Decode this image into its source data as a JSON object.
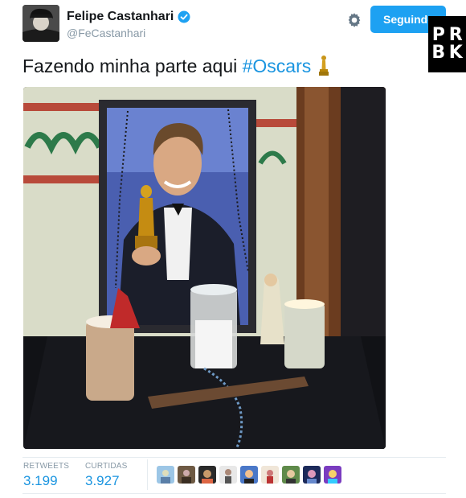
{
  "author": {
    "name": "Felipe Castanhari",
    "handle": "@FeCastanhari",
    "verified": true,
    "avatar_icon": "profile-avatar"
  },
  "header": {
    "settings_icon": "gear-icon",
    "follow_button_label": "Seguindo"
  },
  "watermark": {
    "letters": [
      "P",
      "R",
      "B",
      "K"
    ]
  },
  "tweet": {
    "text": "Fazendo minha parte aqui ",
    "hashtag": "#Oscars",
    "emoji": "trophy-icon",
    "media_icon": "photo-altar-leonardo-oscar"
  },
  "stats": {
    "retweets_label": "RETWEETS",
    "retweets_value": "3.199",
    "likes_label": "CURTIDAS",
    "likes_value": "3.927"
  },
  "liker_avatars": [
    "liker-1",
    "liker-2",
    "liker-3",
    "liker-4",
    "liker-5",
    "liker-6",
    "liker-7",
    "liker-8",
    "liker-9"
  ],
  "colors": {
    "accent": "#1da1f2",
    "link": "#1b95e0",
    "muted": "#8899a6",
    "text": "#14171a"
  }
}
